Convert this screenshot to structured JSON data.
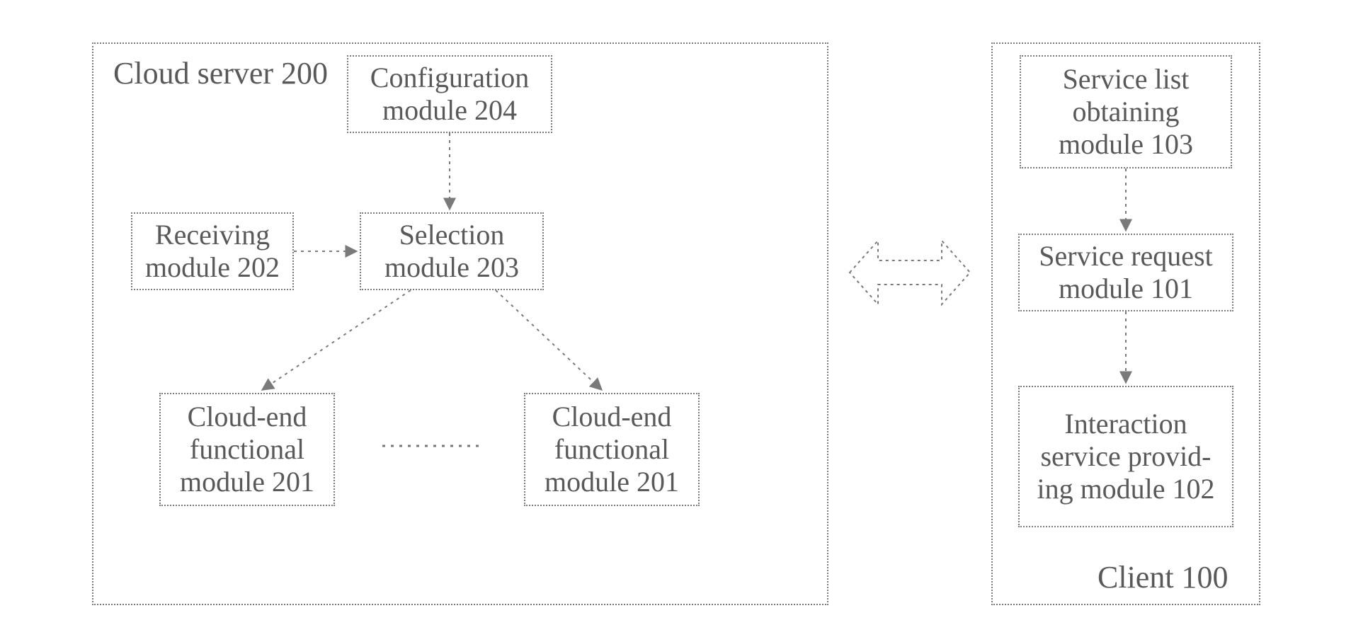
{
  "server": {
    "title": "Cloud server 200",
    "configuration": "Configuration module 204",
    "receiving": "Receiving module 202",
    "selection": "Selection module 203",
    "cloud_end_a": "Cloud-end functional module 201",
    "cloud_end_b": "Cloud-end functional module 201"
  },
  "client": {
    "title": "Client 100",
    "service_list": "Service list obtaining module 103",
    "service_request": "Service request module 101",
    "interaction": "Interaction service provid-ing module 102"
  }
}
